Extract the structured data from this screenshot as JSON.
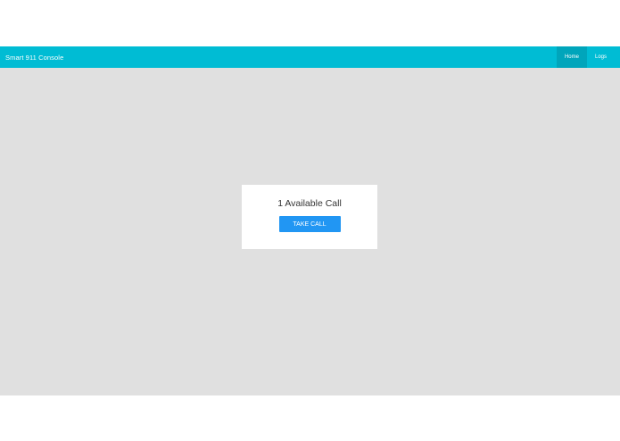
{
  "navbar": {
    "brand": "Smart 911 Console",
    "links": [
      {
        "label": "Home",
        "active": true
      },
      {
        "label": "Logs",
        "active": false
      }
    ],
    "color": "#00bcd4"
  },
  "main": {
    "available_calls_text": "1 Available Call",
    "take_call_label": "TAKE CALL",
    "button_color": "#2196f3"
  }
}
